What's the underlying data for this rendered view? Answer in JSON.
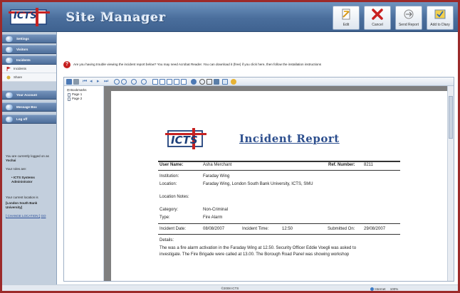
{
  "header": {
    "title": "Site Manager",
    "logo_text": "ICTS",
    "buttons": [
      {
        "label": "Edit",
        "icon": "edit-icon"
      },
      {
        "label": "Cancel",
        "icon": "cancel-icon"
      },
      {
        "label": "Send Report",
        "icon": "send-report-icon"
      },
      {
        "label": "Add to Diary",
        "icon": "diary-icon"
      }
    ]
  },
  "sidebar": {
    "items": [
      {
        "label": "Settings",
        "type": "nav"
      },
      {
        "label": "Visitors",
        "type": "nav"
      },
      {
        "label": "Incidents",
        "type": "nav"
      },
      {
        "label": "Incidents",
        "type": "sub"
      },
      {
        "label": "Share",
        "type": "sub"
      },
      {
        "label": "Your Account",
        "type": "nav"
      },
      {
        "label": "Message Box",
        "type": "nav"
      },
      {
        "label": "Log off",
        "type": "nav"
      }
    ],
    "user_info": {
      "logged_in_prefix": "You are currently logged on as",
      "username": "Yochai",
      "roles_label": "Your roles are:",
      "role": "ICTS Systems Administrator",
      "location_label": "Your current location is",
      "location": "[London South Bank University]",
      "change_location": "[ CHANGE LOCATION ]",
      "go": "GO"
    }
  },
  "notice": "Are you having trouble viewing the incident report below? You may need Acrobat Reader. You can download it (free) if you click here, then follow the installation instructions",
  "bookmarks": {
    "root": "Bookmarks",
    "pages": [
      "Page 1",
      "Page 2"
    ]
  },
  "report": {
    "logo_text": "ICTS",
    "title": "Incident Report",
    "user_name_label": "User Name:",
    "user_name": "Asha Merchant",
    "ref_label": "Ref. Number:",
    "ref_value": "8211",
    "institution_label": "Institution:",
    "institution": "Faraday Wing",
    "location_label": "Location:",
    "location": "Faraday Wing, London South Bank University, ICTS, SMU",
    "location_notes_label": "Location Notes:",
    "category_label": "Category:",
    "category": "Non-Criminal",
    "type_label": "Type:",
    "type": "Fire Alarm",
    "incident_date_label": "Incident Date:",
    "incident_date": "08/08/2007",
    "incident_time_label": "Incident Time:",
    "incident_time": "12:50",
    "submitted_label": "Submitted On:",
    "submitted": "29/08/2007",
    "details_label": "Details:",
    "details_line1": "The was a fire alarm activation in the Faraday Wing at 12.50. Security Officer Eddie Voegli was asked to",
    "details_line2": "investigate. The Fire Brigade were called at 13.00. The Borough Road Panel was showing workshop"
  },
  "footer": "©2008 ICTS",
  "statusbar": {
    "zone": "Internet",
    "zoom": "100%"
  }
}
